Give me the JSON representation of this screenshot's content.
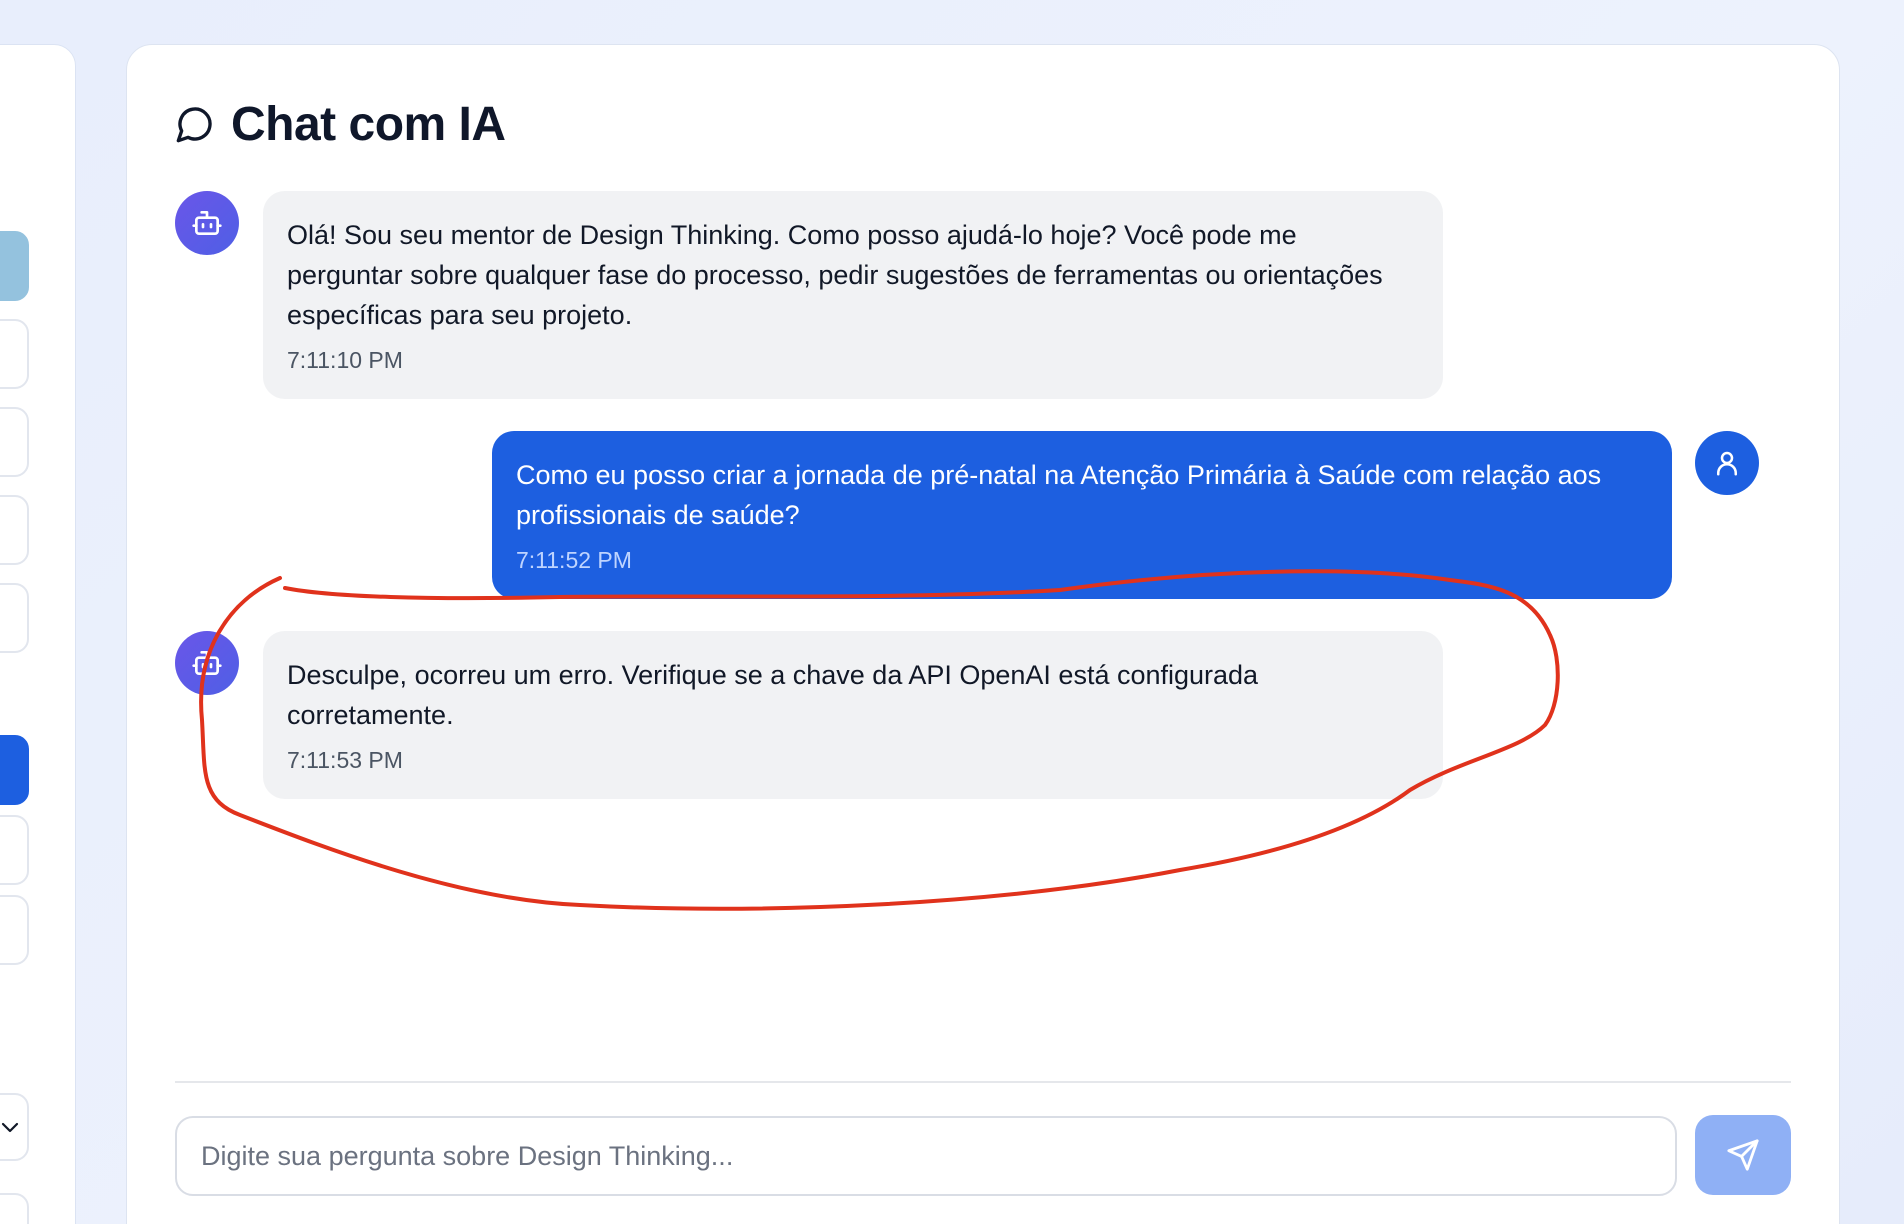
{
  "header": {
    "title": "Chat com IA",
    "icon": "message-circle-icon"
  },
  "messages": [
    {
      "role": "bot",
      "text": "Olá! Sou seu mentor de Design Thinking. Como posso ajudá-lo hoje? Você pode me perguntar sobre qualquer fase do processo, pedir sugestões de ferramentas ou orientações específicas para seu projeto.",
      "time": "7:11:10 PM"
    },
    {
      "role": "user",
      "text": "Como eu posso criar a jornada de pré-natal na Atenção Primária à Saúde com relação aos profissionais de saúde?",
      "time": "7:11:52 PM"
    },
    {
      "role": "bot",
      "text": "Desculpe, ocorreu um erro. Verifique se a chave da API OpenAI está configurada corretamente.",
      "time": "7:11:53 PM"
    }
  ],
  "composer": {
    "placeholder": "Digite sua pergunta sobre Design Thinking...",
    "send_icon": "send-icon"
  },
  "colors": {
    "user_bubble": "#1d5fe0",
    "bot_bubble": "#f1f2f4",
    "bot_avatar": "#5b5ae6",
    "annotation_stroke": "#e0321c"
  }
}
